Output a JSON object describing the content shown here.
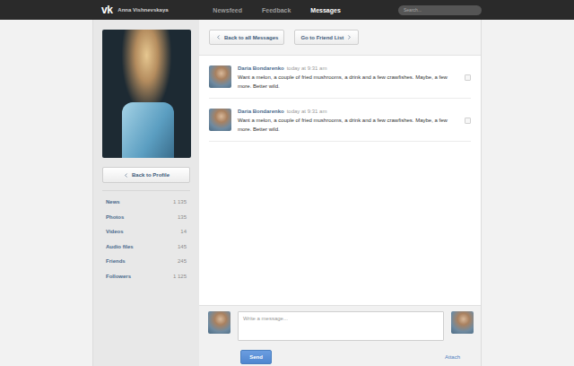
{
  "topbar": {
    "logo": "vk",
    "user": "Anna Vishnevskaya",
    "nav": [
      {
        "label": "Newsfeed",
        "selected": false
      },
      {
        "label": "Feedback",
        "selected": false
      },
      {
        "label": "Messages",
        "selected": true
      }
    ],
    "search": {
      "placeholder": "Search..."
    }
  },
  "profile": {
    "back_button": "Back to Profile",
    "stats": [
      {
        "label": "News",
        "count": "1 135"
      },
      {
        "label": "Photos",
        "count": "135"
      },
      {
        "label": "Videos",
        "count": "14"
      },
      {
        "label": "Audio files",
        "count": "145"
      },
      {
        "label": "Friends",
        "count": "245"
      },
      {
        "label": "Followers",
        "count": "1 125"
      }
    ]
  },
  "toolbar": {
    "back_button": "Back to all Messages",
    "friends_button": "Go to Friend List"
  },
  "messages": [
    {
      "author": "Daria Bondarenko",
      "time": "today at 9:31 am",
      "text": "Want a melon, a couple of fried mushrooms, a drink and a few crawfishes. Maybe, a few more. Better wild.",
      "checked": false
    },
    {
      "author": "Daria Bondarenko",
      "time": "today at 9:31 am",
      "text": "Want a melon, a couple of fried mushrooms, a drink and a few crawfishes. Maybe, a few more. Better wild.",
      "checked": false
    }
  ],
  "compose": {
    "placeholder": "Write a message...",
    "send": "Send",
    "attach": "Attach"
  }
}
